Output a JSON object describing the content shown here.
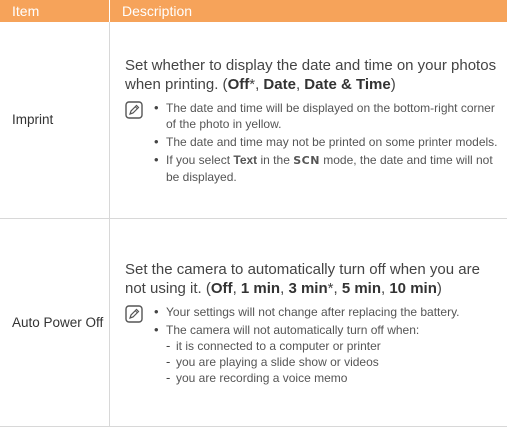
{
  "header": {
    "item": "Item",
    "description": "Description"
  },
  "rows": [
    {
      "item": "Imprint",
      "lead": {
        "text": "Set whether to display the date and time on your photos when printing. (",
        "opt1": "Off",
        "opt1_mark": "*",
        "sep1": ", ",
        "opt2": "Date",
        "sep2": ", ",
        "opt3": "Date & Time",
        "close": ")"
      },
      "notes": [
        "The date and time will be displayed on the bottom-right corner of the photo in yellow.",
        "The date and time may not be printed on some printer models."
      ],
      "note3": {
        "pre": "If you select ",
        "text_label": "Text",
        "mid": " in the ",
        "scn": "SCN",
        "post": " mode, the date and time will not be displayed."
      }
    },
    {
      "item": "Auto Power Off",
      "lead": {
        "text": "Set the camera to automatically turn off when you are not using it. (",
        "opt1": "Off",
        "sep1": ", ",
        "opt2": "1 min",
        "sep2": ", ",
        "opt3": "3 min",
        "opt3_mark": "*",
        "sep3": ", ",
        "opt4": "5 min",
        "sep4": ", ",
        "opt5": "10 min",
        "close": ")"
      },
      "notes": [
        "Your settings will not change after replacing the battery.",
        "The camera will not automatically turn off when:"
      ],
      "subnotes": [
        "it is connected to a computer or printer",
        "you are playing a slide show or videos",
        "you are recording a voice memo"
      ]
    }
  ]
}
